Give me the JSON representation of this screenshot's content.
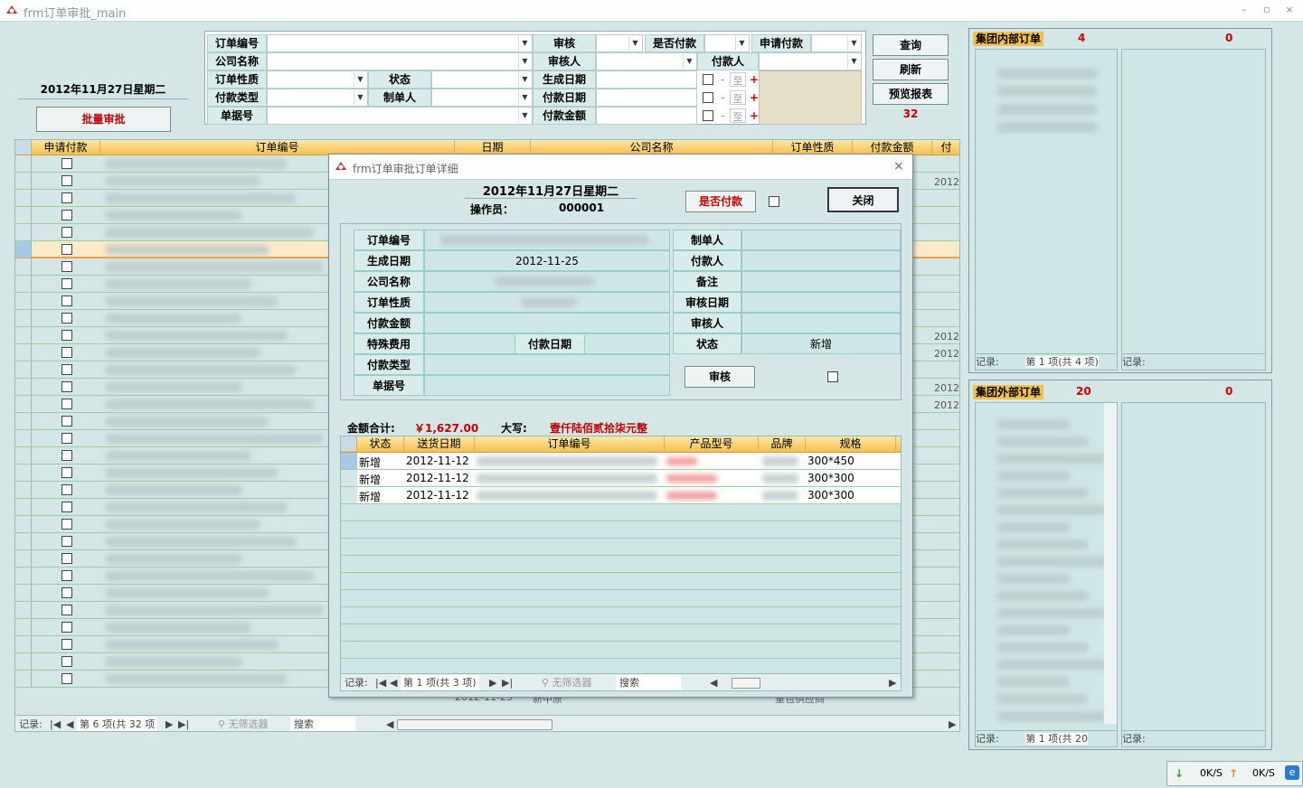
{
  "window": {
    "title": "frm订单审批_main",
    "min": "–",
    "max": "▫",
    "close": "×"
  },
  "date_label": "2012年11月27日星期二",
  "batch_approve": "批量审批",
  "filters": {
    "order_no": "订单编号",
    "approve": "审核",
    "is_apply_pay": "是否付款",
    "apply_pay": "申请付款",
    "company": "公司名称",
    "approver": "审核人",
    "payer": "付款人",
    "order_type": "订单性质",
    "status": "状态",
    "gen_date": "生成日期",
    "pay_type": "付款类型",
    "maker": "制单人",
    "pay_date": "付款日期",
    "doc_no": "单据号",
    "pay_amount": "付款金额",
    "to": "至",
    "plus": "+",
    "dash": "-"
  },
  "buttons": {
    "query": "查询",
    "refresh": "刷新",
    "preview": "预览报表",
    "count": "32"
  },
  "grid": {
    "headers": [
      "申请付款",
      "订单编号",
      "日期",
      "公司名称",
      "订单性质",
      "付款金额",
      "付"
    ],
    "row_years": [
      "2012",
      "2012",
      "2012",
      "2012",
      "2012"
    ],
    "bottom_row": {
      "date": "2012-11-23",
      "company": "新中原",
      "type": "重包供应商"
    },
    "nav": {
      "record": "记录:",
      "pos": "第 6 项(共 32 项",
      "nofilter": "无筛选器",
      "search": "搜索"
    }
  },
  "right_top": {
    "title": "集团内部订单",
    "count1": "4",
    "count2": "0",
    "nav1": "第 1 项(共 4 项)",
    "record": "记录:"
  },
  "right_bottom": {
    "title": "集团外部订单",
    "count1": "20",
    "count2": "0",
    "nav1": "第 1 项(共 20",
    "record": "记录:"
  },
  "dialog": {
    "title": "frm订单审批订单详细",
    "date": "2012年11月27日星期二",
    "operator_label": "操作员：",
    "operator": "000001",
    "is_paid": "是否付款",
    "close": "关闭",
    "left_fields": [
      {
        "label": "订单编号",
        "value": ""
      },
      {
        "label": "生成日期",
        "value": "2012-11-25"
      },
      {
        "label": "公司名称",
        "value": ""
      },
      {
        "label": "订单性质",
        "value": ""
      },
      {
        "label": "付款金额",
        "value": ""
      },
      {
        "label": "特殊费用",
        "value": ""
      },
      {
        "label": "付款类型",
        "value": ""
      },
      {
        "label": "单据号",
        "value": ""
      }
    ],
    "pay_date_label": "付款日期",
    "right_fields": [
      {
        "label": "制单人",
        "value": ""
      },
      {
        "label": "付款人",
        "value": ""
      },
      {
        "label": "备注",
        "value": ""
      },
      {
        "label": "审核日期",
        "value": ""
      },
      {
        "label": "审核人",
        "value": ""
      },
      {
        "label": "状态",
        "value": "新增"
      }
    ],
    "approve_btn": "审核",
    "total_label": "金额合计:",
    "total": "￥1,627.00",
    "capital_label": "大写:",
    "capital": "壹仟陆佰贰拾柒元整",
    "detail_headers": [
      "状态",
      "送货日期",
      "订单编号",
      "产品型号",
      "品牌",
      "规格"
    ],
    "detail_rows": [
      {
        "status": "新增",
        "date": "2012-11-12",
        "spec": "300*450"
      },
      {
        "status": "新增",
        "date": "2012-11-12",
        "spec": "300*300"
      },
      {
        "status": "新增",
        "date": "2012-11-12",
        "spec": "300*300"
      }
    ],
    "nav": {
      "record": "记录:",
      "pos": "第 1 项(共 3 项)",
      "nofilter": "无筛选器",
      "search": "搜索"
    }
  },
  "status": {
    "down": "0K/S",
    "up": "0K/S"
  }
}
